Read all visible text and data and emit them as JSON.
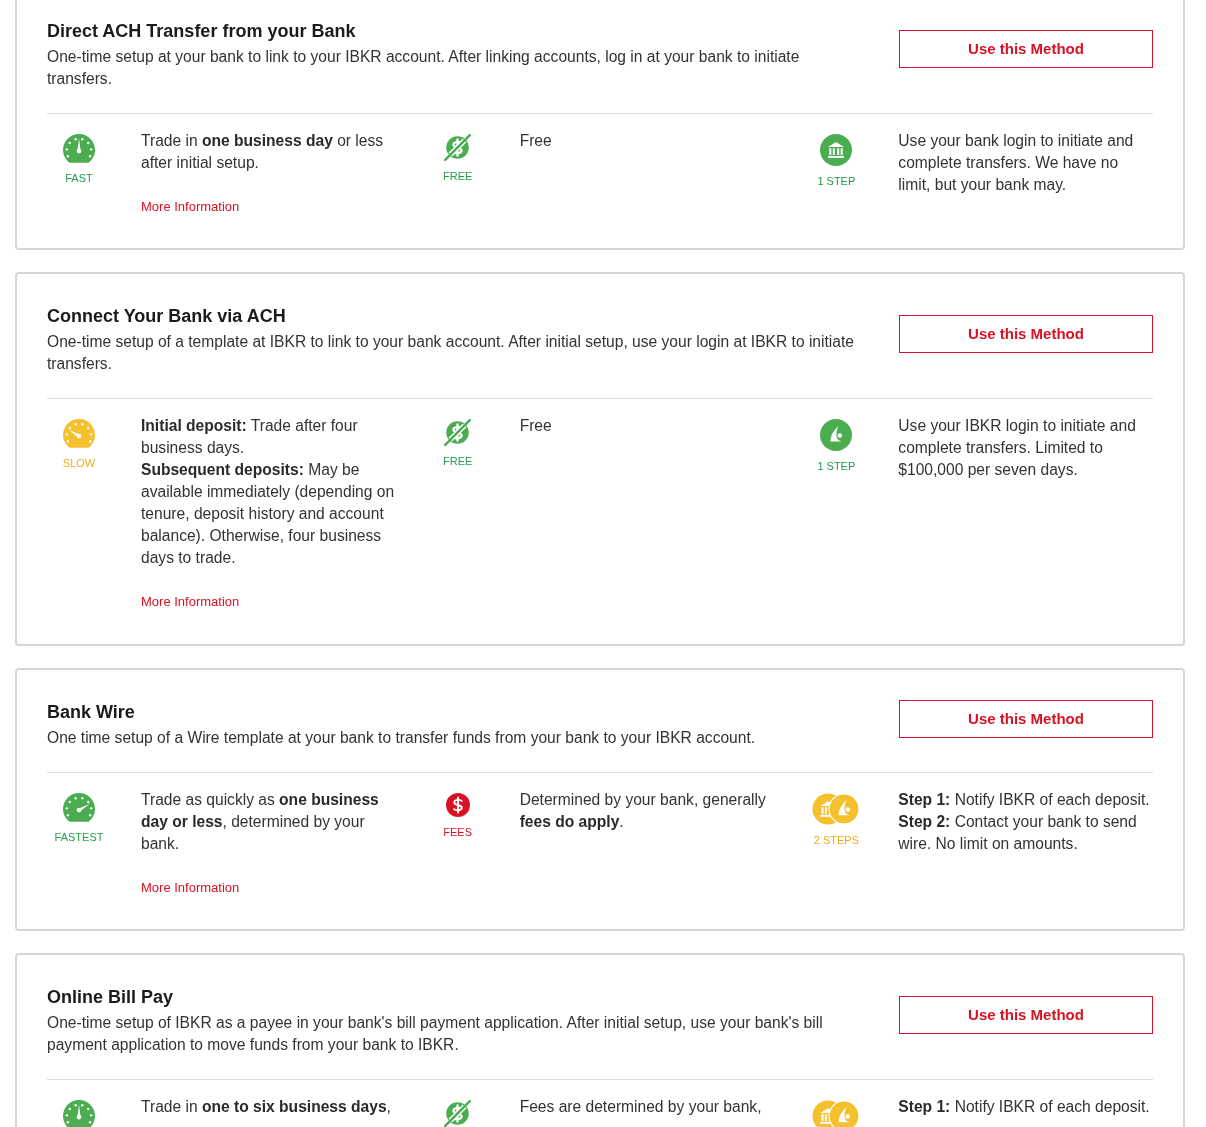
{
  "methods": [
    {
      "title": "Direct ACH Transfer from your Bank",
      "description": "One-time setup at your bank to link to your IBKR account. After linking accounts, log in at your bank to initiate transfers.",
      "button": "Use this Method",
      "features": [
        {
          "kind": "fast",
          "label": "FAST",
          "text": [
            "Trade in **one business day** or less after initial setup."
          ],
          "link": "More Information"
        },
        {
          "kind": "free",
          "label": "FREE",
          "text": [
            "Free"
          ]
        },
        {
          "kind": "bank-step",
          "label": "1 STEP",
          "text": [
            "Use your bank login to initiate and complete transfers. We have no limit, but your bank may."
          ]
        }
      ]
    },
    {
      "title": "Connect Your Bank via ACH",
      "description": "One-time setup of a template at IBKR to link to your bank account. After initial setup, use your login at IBKR to initiate transfers.",
      "button": "Use this Method",
      "features": [
        {
          "kind": "slow",
          "label": "SLOW",
          "text": [
            "**Initial deposit:** Trade after four business days.",
            "**Subsequent deposits:** May be available immediately (depending on tenure, deposit history and account balance). Otherwise, four business days to trade."
          ],
          "link": "More Information"
        },
        {
          "kind": "free",
          "label": "FREE",
          "text": [
            "Free"
          ]
        },
        {
          "kind": "login-step",
          "label": "1 STEP",
          "text": [
            "Use your IBKR login to initiate and complete transfers. Limited to $100,000 per seven days."
          ]
        }
      ]
    },
    {
      "title": "Bank Wire",
      "description": "One time setup of a Wire template at your bank to transfer funds from your bank to your IBKR account.",
      "button": "Use this Method",
      "features": [
        {
          "kind": "fastest",
          "label": "FASTEST",
          "text": [
            "Trade as quickly as **one business day or less**, determined by your bank."
          ],
          "link": "More Information"
        },
        {
          "kind": "fees",
          "label": "FEES",
          "text": [
            "Determined by your bank, generally **fees do apply**."
          ]
        },
        {
          "kind": "two-steps",
          "label": "2 STEPS",
          "text": [
            "**Step 1:** Notify IBKR of each deposit.",
            "**Step 2:** Contact your bank to send wire. No limit on amounts."
          ]
        }
      ]
    },
    {
      "title": "Online Bill Pay",
      "description": "One-time setup of IBKR as a payee in your bank's bill payment application. After initial setup, use your bank's bill payment application to move funds from your bank to IBKR.",
      "button": "Use this Method",
      "features": [
        {
          "kind": "fast",
          "text": [
            "Trade in **one to six business days**,"
          ]
        },
        {
          "kind": "free",
          "text": [
            "Fees are determined by your bank,"
          ]
        },
        {
          "kind": "two-steps",
          "text": [
            "**Step 1:** Notify IBKR of each deposit."
          ]
        }
      ]
    }
  ]
}
